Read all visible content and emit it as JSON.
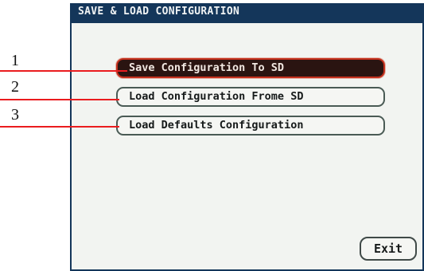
{
  "screen": {
    "title": "SAVE & LOAD CONFIGURATION"
  },
  "menu": {
    "items": [
      {
        "label": "Save Configuration To SD",
        "selected": true
      },
      {
        "label": "Load Configuration Frome SD",
        "selected": false
      },
      {
        "label": "Load Defaults Configuration",
        "selected": false
      }
    ],
    "exit_label": "Exit"
  },
  "callouts": [
    "1",
    "2",
    "3"
  ],
  "colors": {
    "title_bar": "#14365a",
    "panel": "#f2f4f1",
    "selected_fill": "#2a1411",
    "selected_border": "#c4301d",
    "callout_line": "#ea1c1f"
  }
}
